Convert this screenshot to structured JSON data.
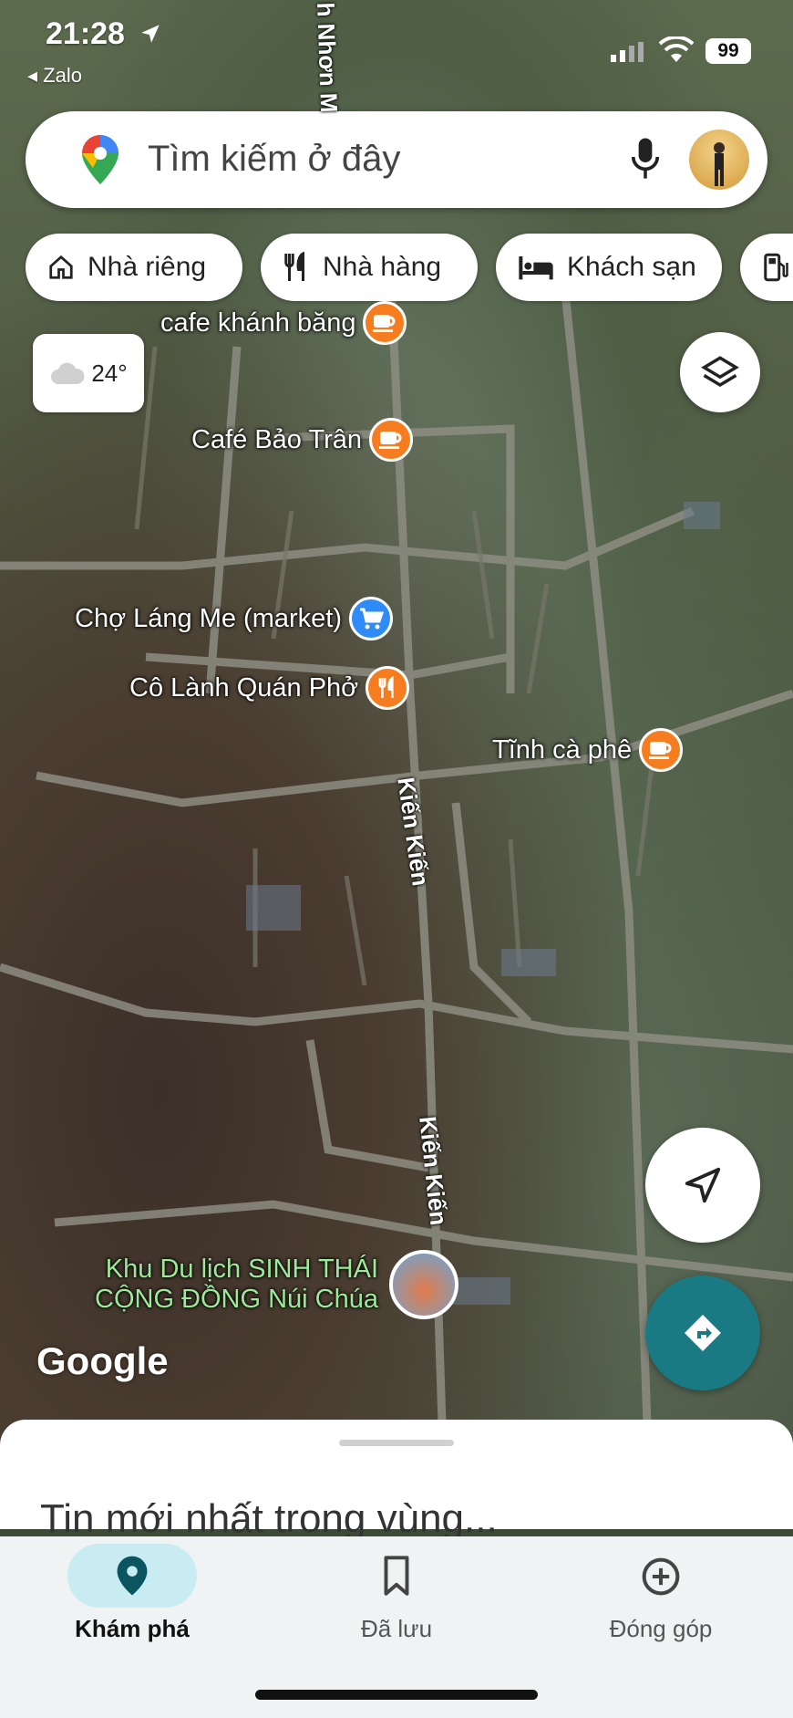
{
  "status_bar": {
    "time": "21:28",
    "back_app": "Zalo",
    "battery": "99"
  },
  "search": {
    "placeholder": "Tìm kiếm ở đây"
  },
  "chips": [
    {
      "label": "Nhà riêng",
      "icon": "home-icon"
    },
    {
      "label": "Nhà hàng",
      "icon": "restaurant-icon"
    },
    {
      "label": "Khách sạn",
      "icon": "hotel-icon"
    },
    {
      "label": "",
      "icon": "gas-station-icon"
    }
  ],
  "weather": {
    "temp": "24°",
    "icon": "cloud-icon"
  },
  "pois": [
    {
      "label": "cafe khánh băng",
      "type": "cafe",
      "color": "#f57c1f"
    },
    {
      "label": "Café Bảo Trân",
      "type": "cafe",
      "color": "#f57c1f"
    },
    {
      "label": "Chợ Láng Me (market)",
      "type": "shopping",
      "color": "#2f8bf5"
    },
    {
      "label": "Cô Lành Quán Phở",
      "type": "restaurant",
      "color": "#f57c1f"
    },
    {
      "label": "Tĩnh cà phê",
      "type": "cafe",
      "color": "#f57c1f"
    }
  ],
  "attraction": {
    "line1": "Khu Du lịch SINH THÁI",
    "line2": "CỘNG ĐỒNG Núi Chúa",
    "color": "#9ee89a"
  },
  "road_labels": [
    "Kiến Kiến",
    "Kiến Kiến",
    "h Nhơn M"
  ],
  "map_brand": "Google",
  "bottom_sheet": {
    "title": "Tin mới nhất trong vùng..."
  },
  "nav": [
    {
      "label": "Khám phá",
      "icon": "explore-pin-icon",
      "active": true
    },
    {
      "label": "Đã lưu",
      "icon": "bookmark-icon",
      "active": false
    },
    {
      "label": "Đóng góp",
      "icon": "add-circle-icon",
      "active": false
    }
  ],
  "colors": {
    "accent": "#1a7a83",
    "active_nav_bg": "#c8ecf2",
    "poi_orange": "#f57c1f",
    "poi_blue": "#2f8bf5"
  }
}
